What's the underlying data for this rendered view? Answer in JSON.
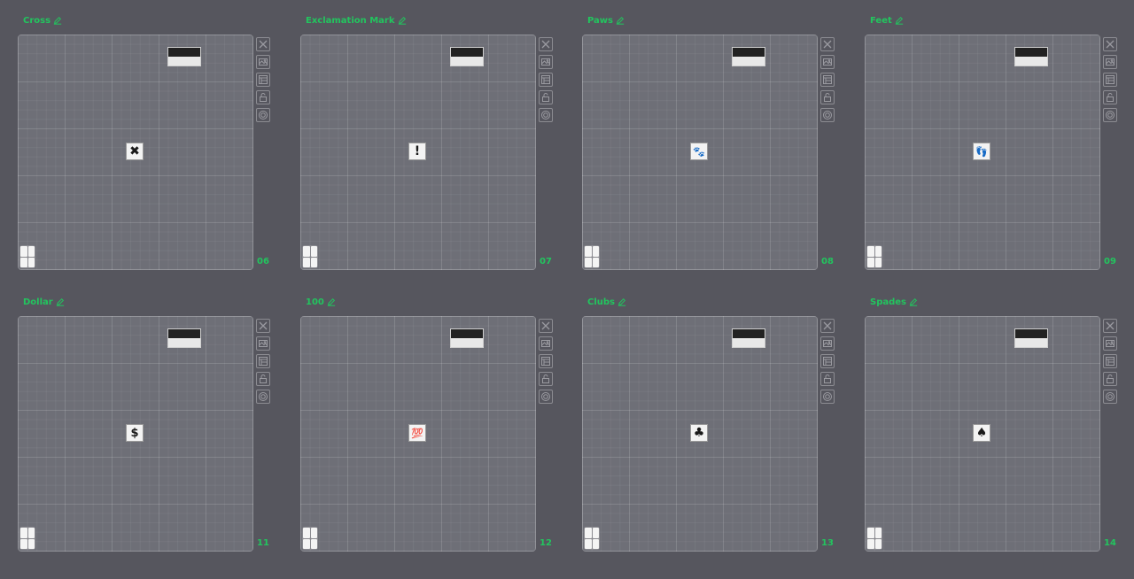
{
  "cards": [
    {
      "title": "Cross",
      "number": "06",
      "emblem": "✖",
      "emblem_size": 14
    },
    {
      "title": "Exclamation Mark",
      "number": "07",
      "emblem": "!",
      "emblem_size": 14
    },
    {
      "title": "Paws",
      "number": "08",
      "emblem": "🐾",
      "emblem_size": 11
    },
    {
      "title": "Feet",
      "number": "09",
      "emblem": "👣",
      "emblem_size": 11
    },
    {
      "title": "Dollar",
      "number": "11",
      "emblem": "$",
      "emblem_size": 13
    },
    {
      "title": "100",
      "number": "12",
      "emblem": "💯",
      "emblem_size": 11
    },
    {
      "title": "Clubs",
      "number": "13",
      "emblem": "♣",
      "emblem_size": 14
    },
    {
      "title": "Spades",
      "number": "14",
      "emblem": "♠",
      "emblem_size": 14
    }
  ],
  "icons": {
    "title_edit": "pencil-icon",
    "tools": [
      "close-icon",
      "image-icon",
      "layout-icon",
      "lock-icon",
      "target-icon"
    ],
    "grid": "grid-icon"
  },
  "colors": {
    "accent": "#22c55e",
    "background": "#56565e",
    "canvas": "#6e6f77"
  }
}
